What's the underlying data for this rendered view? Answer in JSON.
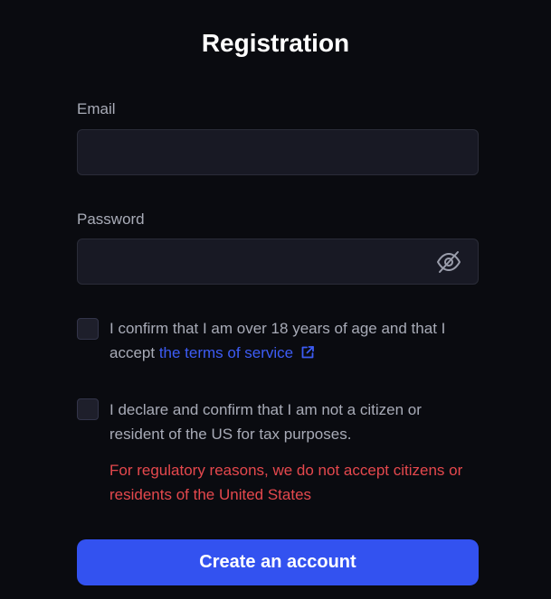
{
  "form": {
    "title": "Registration",
    "email": {
      "label": "Email",
      "value": "",
      "placeholder": ""
    },
    "password": {
      "label": "Password",
      "value": "",
      "placeholder": ""
    },
    "age_confirm": {
      "checked": false,
      "text": "I confirm that I am over 18 years of age and that I accept ",
      "link_text": "the terms of service"
    },
    "us_declaration": {
      "checked": false,
      "text": "I declare and confirm that I am not a citizen or resident of the US for tax purposes."
    },
    "warning": "For regulatory reasons, we do not accept citizens or residents of the United States",
    "submit_label": "Create an account"
  },
  "icons": {
    "password_toggle": "eye-slash-icon",
    "terms_link": "external-link-icon"
  },
  "colors": {
    "background": "#0a0b10",
    "field_bg": "#181924",
    "accent": "#3352f0",
    "link": "#3d5cf5",
    "error": "#e5484d"
  }
}
